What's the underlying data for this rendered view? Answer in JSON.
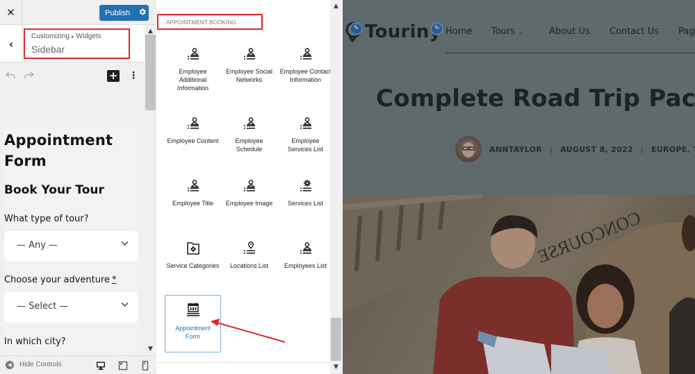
{
  "sidebar": {
    "close_label": "✕",
    "publish_label": "Publish",
    "breadcrumb": [
      "Customizing",
      "Widgets"
    ],
    "breadcrumb_separator": "▸",
    "title": "Sidebar",
    "inserter_label": "+",
    "more_label": "⋮",
    "form": {
      "title": "Appointment Form",
      "subtitle": "Book Your Tour",
      "fields": [
        {
          "label": "What type of tour?",
          "required": false,
          "value": "— Any —"
        },
        {
          "label": "Choose your adventure",
          "required": true,
          "required_mark": "*",
          "value": "— Select —"
        },
        {
          "label": "In which city?",
          "required": false
        }
      ]
    },
    "footer": {
      "hide_controls_label": "Hide Controls",
      "devices": [
        "desktop",
        "tablet",
        "mobile"
      ]
    }
  },
  "panel": {
    "category": "APPOINTMENT BOOKING",
    "blocks": [
      {
        "label": "Employee Additional Information",
        "icon": "employee-list-icon"
      },
      {
        "label": "Employee Social Networks",
        "icon": "employee-list-icon"
      },
      {
        "label": "Employee Contact Information",
        "icon": "employee-list-icon"
      },
      {
        "label": "Employee Content",
        "icon": "employee-list-icon"
      },
      {
        "label": "Employee Schedule",
        "icon": "employee-list-icon"
      },
      {
        "label": "Employee Services List",
        "icon": "employee-list-icon"
      },
      {
        "label": "Employee Title",
        "icon": "employee-list-icon"
      },
      {
        "label": "Employee Image",
        "icon": "employee-list-icon"
      },
      {
        "label": "Services List",
        "icon": "services-list-icon"
      },
      {
        "label": "Service Categories",
        "icon": "folder-gear-icon"
      },
      {
        "label": "Locations List",
        "icon": "location-list-icon"
      },
      {
        "label": "Employees List",
        "icon": "employee-list-icon"
      },
      {
        "label": "Appointment Form",
        "icon": "calendar-form-icon",
        "selected": true
      }
    ]
  },
  "preview": {
    "logo_text": "Touriny",
    "nav": [
      "Home",
      "Tours",
      "About Us",
      "Contact Us",
      "Page"
    ],
    "post_title": "Complete Road Trip Pack",
    "author": "ANNTAYLOR",
    "date": "AUGUST 8, 2022",
    "categories": "EUROPE, TO",
    "hero_sign_text": "CONCOURSE"
  },
  "colors": {
    "accent": "#2271b1",
    "highlight": "#e0262a",
    "overlay": "#5e6a6b"
  }
}
